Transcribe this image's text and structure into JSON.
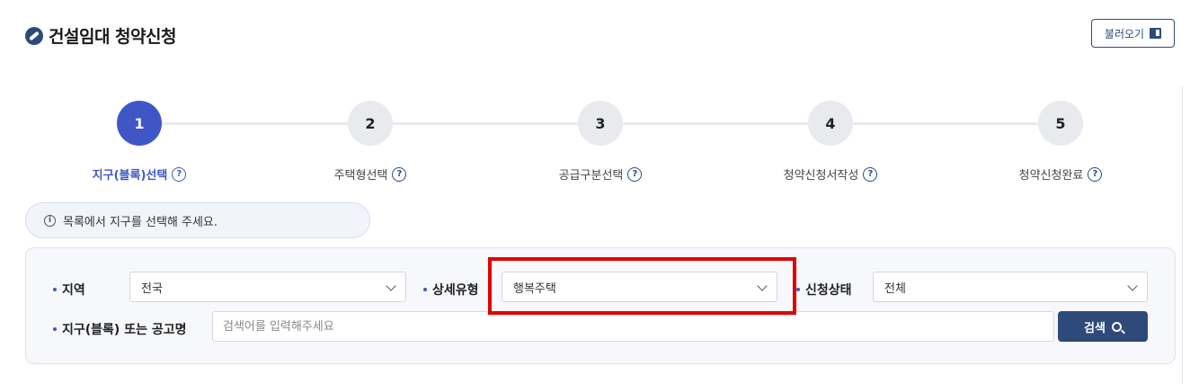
{
  "header": {
    "title": "건설임대 청약신청",
    "load_button_label": "불러오기"
  },
  "stepper": {
    "steps": [
      {
        "number": "1",
        "label": "지구(블록)선택",
        "active": true
      },
      {
        "number": "2",
        "label": "주택형선택",
        "active": false
      },
      {
        "number": "3",
        "label": "공급구분선택",
        "active": false
      },
      {
        "number": "4",
        "label": "청약신청서작성",
        "active": false
      },
      {
        "number": "5",
        "label": "청약신청완료",
        "active": false
      }
    ],
    "help_glyph": "?"
  },
  "notice": {
    "text": "목록에서 지구를 선택해 주세요.",
    "icon_glyph": "i"
  },
  "filters": {
    "region": {
      "label": "지역",
      "value": "전국"
    },
    "detail_type": {
      "label": "상세유형",
      "value": "행복주택"
    },
    "status": {
      "label": "신청상태",
      "value": "전체"
    },
    "block_search": {
      "label": "지구(블록) 또는 공고명",
      "placeholder": "검색어를 입력해주세요"
    },
    "search_button_label": "검색"
  },
  "colors": {
    "accent": "#3f57c6",
    "navy": "#2e4a7a",
    "highlight": "#e00000",
    "filter_bg": "#f7f8fb"
  },
  "icons": {
    "title": "title-logo-icon",
    "load": "bookmark-icon",
    "help": "question-circle-icon",
    "info": "info-circle-icon",
    "chevron": "chevron-down-icon",
    "search": "search-icon"
  }
}
